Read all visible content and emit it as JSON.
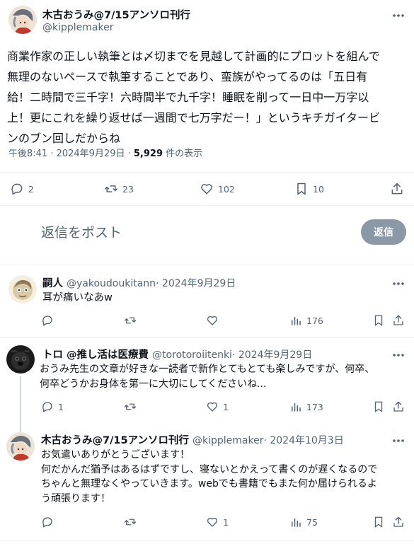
{
  "main": {
    "author_name": "木古おうみ@7/15アンソロ刊行",
    "author_handle": "@kipplemaker",
    "text_lines": [
      "商業作家の正しい執筆とは〆切までを見越して計画的にプロットを組んで",
      "無理のないペースで執筆することであり、蛮族がやってるのは「五日有",
      "給！二時間で三千字！六時間半で九千字！睡眠を削って一日中一万字以",
      "上！更にこれを繰り返せば一週間で七万字だー！」というキチガイタービ",
      "ンのブン回しだからね"
    ],
    "time": "午後8:41 · 2024年9月29日 · ",
    "views_count": "5,929",
    "views_label": " 件の表示",
    "stats": {
      "replies": "2",
      "reposts": "23",
      "likes": "102",
      "bookmarks": "10"
    }
  },
  "composer": {
    "placeholder": "返信をポスト",
    "button_label": "返信"
  },
  "replies": [
    {
      "name": "嗣人",
      "handle": "@yakoudoukitann",
      "date": " · 2024年9月29日",
      "lines": [
        "耳が痛いなあw"
      ],
      "replies": "",
      "reposts": "",
      "likes": "",
      "views": "176"
    },
    {
      "name": "トロ @推し活は医療費",
      "handle": "@torotoroiitenki",
      "date": " · 2024年9月29日",
      "lines": [
        "おうみ先生の文章が好きな一読者で新作とてもとても楽しみですが、何卒、",
        "何卒どうかお身体を第一に大切にしてくださいね..."
      ],
      "replies": "1",
      "reposts": "",
      "likes": "1",
      "views": "173"
    },
    {
      "name": "木古おうみ@7/15アンソロ刊行",
      "handle": "@kipplemaker",
      "date": " · 2024年10月3日",
      "lines": [
        "お気遣いありがとうございます！",
        "何だかんだ猶予はあるはずですし、寝ないとかえって書くのが遅くなるので",
        "ちゃんと無理なくやっていきます。webでも書籍でもまた何か届けられるよ",
        "う頑張ります！"
      ],
      "replies": "",
      "reposts": "",
      "likes": "1",
      "views": "75"
    }
  ],
  "icons": {
    "more": "more-horizontal-icon",
    "reply": "speech-bubble-icon",
    "repost": "repost-arrows-icon",
    "like": "heart-icon",
    "bookmark": "bookmark-icon",
    "share": "share-upload-icon",
    "views": "bar-chart-icon"
  },
  "colors": {
    "text": "#0f1419",
    "secondary": "#536471",
    "reply_button_bg": "#8b98a5",
    "divider": "#eff3f4",
    "thread_line": "#cfd9de"
  }
}
